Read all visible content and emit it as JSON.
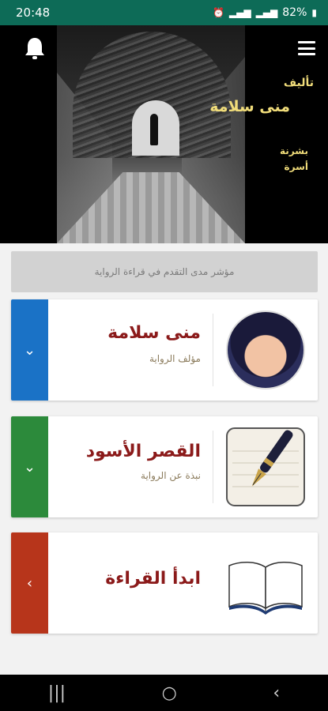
{
  "status": {
    "time": "20:48",
    "battery": "82%",
    "icons": [
      "alarm-icon",
      "signal-icon",
      "signal-icon",
      "battery-icon"
    ]
  },
  "hero": {
    "author_label": "تأليف",
    "author_name": "منى سلامة",
    "tagline_1": "بشرنة",
    "tagline_2": "أسرة"
  },
  "progress": {
    "label": "مؤشر مدى التقدم في قراءة الرواية"
  },
  "cards": [
    {
      "title": "منى سلامة",
      "subtitle": "مؤلف الرواية",
      "color": "#1a72c6",
      "icon": "chevron-down-icon"
    },
    {
      "title": "القصر الأسود",
      "subtitle": "نبذة عن الرواية",
      "color": "#2c8a3b",
      "icon": "chevron-down-icon"
    },
    {
      "title": "ابدأ القراءة",
      "subtitle": "",
      "color": "#b7351b",
      "icon": "chevron-left-icon"
    }
  ],
  "colors": {
    "status_bar": "#0d6b57",
    "title": "#8b1a1a",
    "hero_text": "#f0dc7a"
  }
}
